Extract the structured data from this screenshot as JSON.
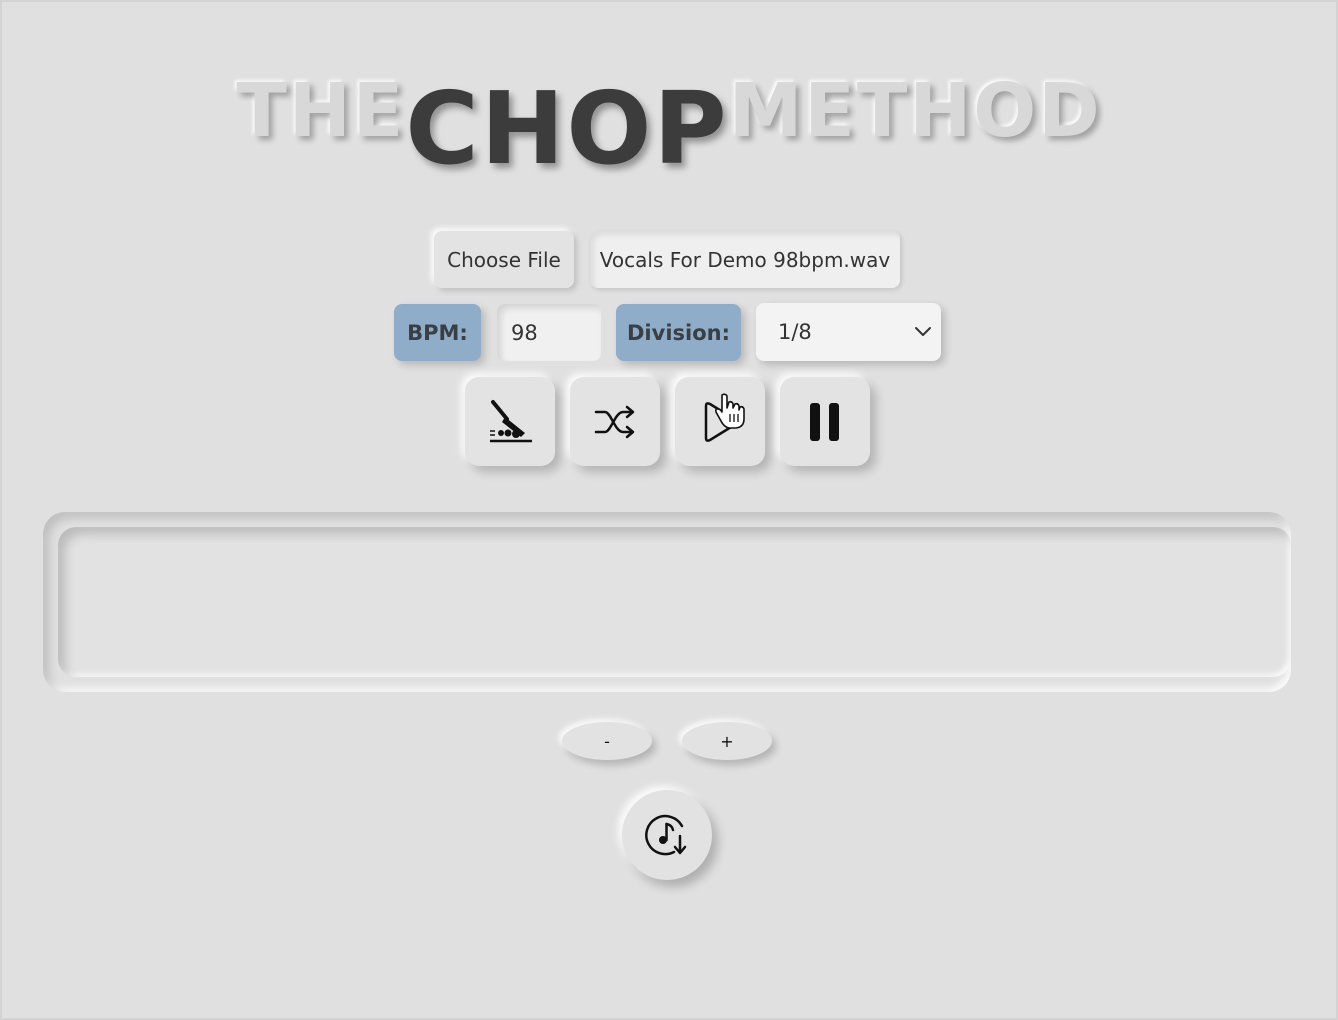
{
  "title": {
    "part1": "THE",
    "part2": "CHOP",
    "part3": "METHOD"
  },
  "file": {
    "choose_label": "Choose File",
    "selected_name": "Vocals For Demo 98bpm.wav"
  },
  "bpm": {
    "label": "BPM:",
    "value": "98"
  },
  "division": {
    "label": "Division:",
    "selected": "1/8"
  },
  "controls": {
    "chop_icon": "knife-chop-icon",
    "shuffle_icon": "shuffle-icon",
    "play_icon": "play-icon",
    "pause_icon": "pause-icon"
  },
  "zoom": {
    "out_label": "-",
    "in_label": "+"
  },
  "export": {
    "icon": "music-download-icon"
  },
  "colors": {
    "background": "#e0e0e0",
    "label_accent": "#8fadc9",
    "title_dark": "#3c3c3c"
  }
}
